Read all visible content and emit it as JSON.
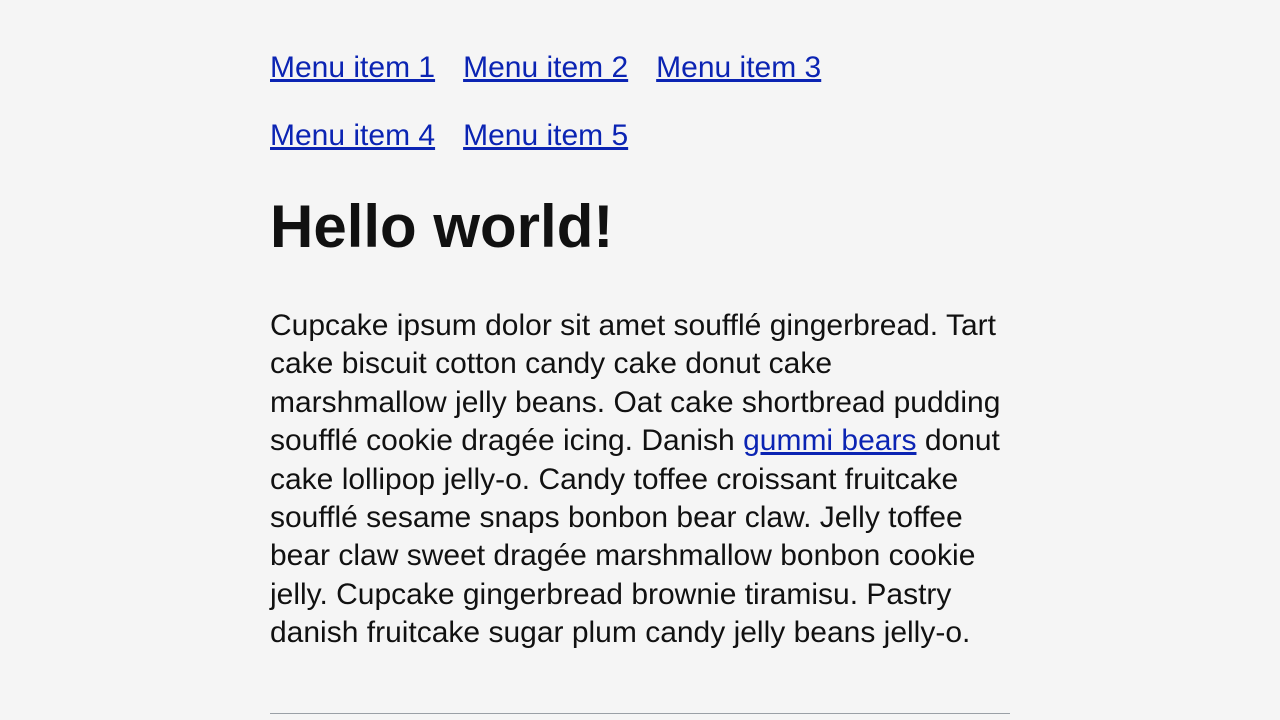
{
  "menu": {
    "items": [
      {
        "label": "Menu item 1"
      },
      {
        "label": "Menu item 2"
      },
      {
        "label": "Menu item 3"
      },
      {
        "label": "Menu item 4"
      },
      {
        "label": "Menu item 5"
      }
    ]
  },
  "heading": "Hello world!",
  "paragraph": {
    "before": "Cupcake ipsum dolor sit amet soufflé gingerbread. Tart cake biscuit cotton candy cake donut cake marshmallow jelly beans. Oat cake shortbread pudding soufflé cookie dragée icing. Danish ",
    "link_text": "gummi bears",
    "after": " donut cake lollipop jelly-o. Candy toffee croissant fruitcake soufflé sesame snaps bonbon bear claw. Jelly toffee bear claw sweet dragée marshmallow bonbon cookie jelly. Cupcake gingerbread brownie tiramisu. Pastry danish fruitcake sugar plum candy jelly beans jelly-o."
  }
}
